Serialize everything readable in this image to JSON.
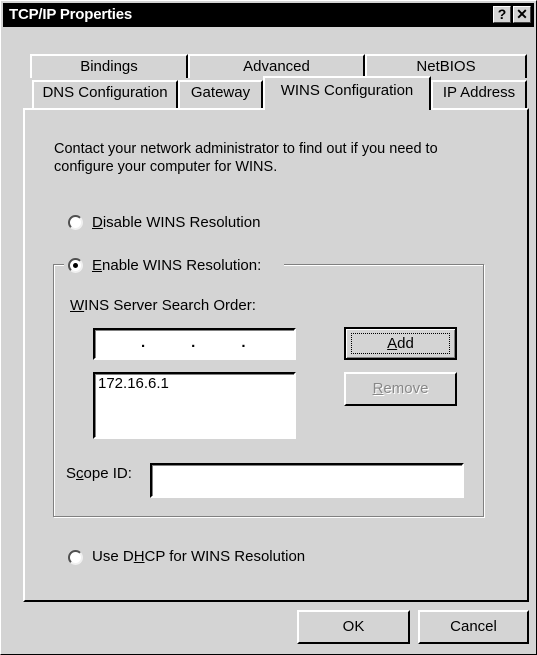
{
  "window": {
    "title": "TCP/IP Properties",
    "help_glyph": "?",
    "close_glyph": "✕"
  },
  "tabs": {
    "row1": [
      "Bindings",
      "Advanced",
      "NetBIOS"
    ],
    "row2": [
      "DNS Configuration",
      "Gateway",
      "WINS Configuration",
      "IP Address"
    ],
    "selected": "WINS Configuration"
  },
  "content": {
    "instructions_line1": "Contact your network administrator to find out if you need to",
    "instructions_line2": "configure your computer for WINS.",
    "disable_option": {
      "mnemonic": "D",
      "rest": "isable WINS Resolution",
      "selected": false
    },
    "enable_option": {
      "mnemonic": "E",
      "rest": "nable WINS Resolution:",
      "selected": true
    },
    "search_order_label": {
      "mnemonic": "W",
      "rest": "INS Server Search Order:"
    },
    "ip_input_value": ".      .      .",
    "add_button": {
      "mnemonic": "A",
      "rest": "dd"
    },
    "remove_button": {
      "mnemonic": "R",
      "rest": "emove",
      "enabled": false
    },
    "server_list": [
      "172.16.6.1"
    ],
    "scope_id_label": {
      "pre": "S",
      "mnemonic": "c",
      "rest": "ope ID:"
    },
    "scope_id_value": "",
    "dhcp_option": {
      "pre": "Use D",
      "mnemonic": "H",
      "rest": "CP for WINS Resolution",
      "selected": false
    }
  },
  "footer": {
    "ok_label": "OK",
    "cancel_label": "Cancel"
  }
}
